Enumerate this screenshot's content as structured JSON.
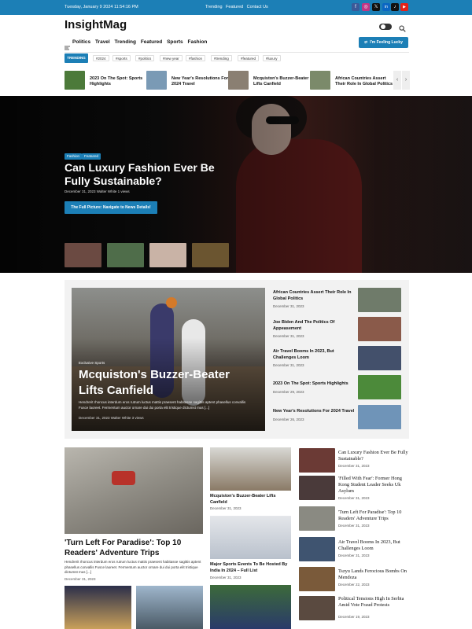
{
  "topbar": {
    "date": "Tuesday, January 9 2024  11:54:16 PM",
    "links": [
      "Trending",
      "Featured",
      "Contact Us"
    ],
    "social": [
      {
        "name": "facebook-icon",
        "glyph": "f",
        "color": "#3b5998"
      },
      {
        "name": "instagram-icon",
        "glyph": "◎",
        "color": "#c13584"
      },
      {
        "name": "x-icon",
        "glyph": "𝕏",
        "color": "#111111"
      },
      {
        "name": "linkedin-icon",
        "glyph": "in",
        "color": "#0a66c2"
      },
      {
        "name": "tiktok-icon",
        "glyph": "♪",
        "color": "#111111"
      },
      {
        "name": "youtube-icon",
        "glyph": "▶",
        "color": "#e62117"
      }
    ]
  },
  "header": {
    "logo": "InsightMag",
    "menu": [
      "Politics",
      "Travel",
      "Trending",
      "Featured",
      "Sports",
      "Fashion"
    ],
    "lucky_button": "I'm Feeling Lucky",
    "accent": "#1c7fb6"
  },
  "trending": {
    "badge": "TRENDING",
    "tags": [
      "#2024",
      "#sports",
      "#politics",
      "#new year",
      "#fashion",
      "#trending",
      "#featured",
      "#luxury"
    ]
  },
  "ticker": [
    {
      "title": "2023 On The Spot: Sports Highlights",
      "thumb": "#4c7a3a"
    },
    {
      "title": "New Year's Resolutions For 2024 Travel",
      "thumb": "#7a9ab5"
    },
    {
      "title": "Mcquiston's Buzzer-Beater Lifts Canfield",
      "thumb": "#8a7f72"
    },
    {
      "title": "African Countries Assert Their Role In Global Politics",
      "thumb": "#7b8a6a"
    }
  ],
  "hero": {
    "categories": [
      "Fashion",
      "Featured"
    ],
    "title": "Can Luxury Fashion Ever Be Fully Sustainable?",
    "meta": "December 31, 2023  Walter White  1 views",
    "cta": "The Full Picture: Navigate to News Details!",
    "thumbs": [
      "#6b4a42",
      "#4f6d4a",
      "#c9b3a6",
      "#6b5530"
    ]
  },
  "featured": {
    "kicker": "Exclusive  Sports",
    "title": "Mcquiston's Buzzer-Beater Lifts Canfield",
    "excerpt": "Hendrerit rhoncus interdum eros rutrum luctus mattis praesent habitasse sagittis aptent phasellus convallis Fusce laoreet. Fermentum auctor ornare dui dui porta elit tristique dictumst mus [...]",
    "meta": "December 31, 2023  Walter White  3 views",
    "side": [
      {
        "title": "African Countries Assert Their Role In Global Politics",
        "date": "December 31, 2023",
        "thumb": "#6f7b6a"
      },
      {
        "title": "Joe Biden And The Politics Of Appeasement",
        "date": "December 31, 2023",
        "thumb": "#8a5a4a"
      },
      {
        "title": "Air Travel Booms In 2023, But Challenges Loom",
        "date": "December 31, 2023",
        "thumb": "#43506b"
      },
      {
        "title": "2023 On The Spot: Sports Highlights",
        "date": "December 29, 2023",
        "thumb": "#4c8a3a"
      },
      {
        "title": "New Year's Resolutions For 2024 Travel",
        "date": "December 26, 2023",
        "thumb": "#6f94b8"
      }
    ]
  },
  "grid": {
    "big": {
      "title": "'Turn Left For Paradise': Top 10 Readers' Adventure Trips",
      "excerpt": "Hendrerit rhoncus interdum eros rutrum luctus mattis praesent habitasse sagittis aptent phasellus convallis Fusce laoreet. Fermentum auctor ornare dui dui porta elit tristique dictumst mus [...]",
      "date": "December 31, 2023"
    },
    "mid": [
      {
        "title": "Mcquiston's Buzzer-Beater Lifts Canfield",
        "date": "December 31, 2023"
      },
      {
        "title": "Major Sports Events To Be Hosted By India In 2024 – Full List",
        "date": "December 31, 2023"
      }
    ],
    "right": [
      {
        "title": "Can Luxury Fashion Ever Be Fully Sustainable?",
        "date": "December 31, 2023",
        "thumb": "#6b3a35"
      },
      {
        "title": "'Filled With Fear': Former Hong Kong Student Leader Seeks Uk Asylum",
        "date": "December 31, 2023",
        "thumb": "#4a3a3a"
      },
      {
        "title": "'Turn Left For Paradise': Top 10 Readers' Adventure Trips",
        "date": "December 31, 2023",
        "thumb": "#8a8a82"
      },
      {
        "title": "Air Travel Booms In 2023, But Challenges Loom",
        "date": "December 31, 2023",
        "thumb": "#3f5470"
      },
      {
        "title": "Tszyu Lands Ferocious Bombs On Mendoza",
        "date": "December 22, 2023",
        "thumb": "#7a5a3a"
      },
      {
        "title": "Political Tensions High In Serbia Amid Vote Fraud Protests",
        "date": "December 19, 2023",
        "thumb": "#5a4a40"
      }
    ]
  }
}
